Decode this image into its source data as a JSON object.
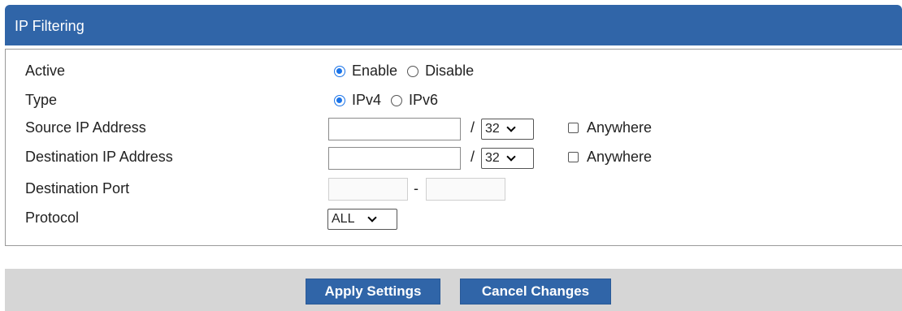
{
  "header": {
    "title": "IP Filtering"
  },
  "form": {
    "active": {
      "label": "Active",
      "options": [
        "Enable",
        "Disable"
      ],
      "selected": "Enable"
    },
    "type": {
      "label": "Type",
      "options": [
        "IPv4",
        "IPv6"
      ],
      "selected": "IPv4"
    },
    "source_ip": {
      "label": "Source IP Address",
      "value": "",
      "prefix": "32",
      "anywhere_label": "Anywhere",
      "anywhere_checked": false
    },
    "dest_ip": {
      "label": "Destination IP Address",
      "value": "",
      "prefix": "32",
      "anywhere_label": "Anywhere",
      "anywhere_checked": false
    },
    "dest_port": {
      "label": "Destination Port",
      "from": "",
      "to": "",
      "separator": "-"
    },
    "protocol": {
      "label": "Protocol",
      "selected": "ALL"
    },
    "slash": "/"
  },
  "footer": {
    "apply_label": "Apply Settings",
    "cancel_label": "Cancel Changes"
  },
  "colors": {
    "header_bg": "#3065a8",
    "button_bg": "#3065a8",
    "footer_bg": "#d6d6d6"
  }
}
